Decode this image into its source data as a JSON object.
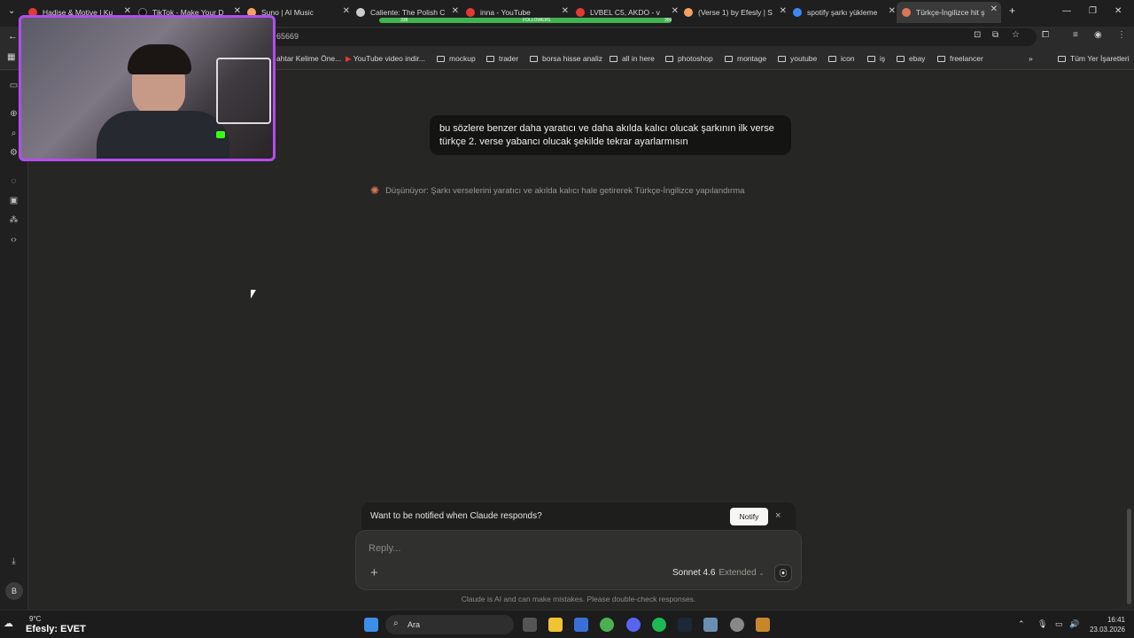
{
  "browser": {
    "tabs": [
      {
        "label": "Hadise & Motive | Ku",
        "color": "#e53935"
      },
      {
        "label": "TikTok - Make Your D",
        "color": "#111111"
      },
      {
        "label": "Suno | AI Music",
        "color": "#f4a261"
      },
      {
        "label": "Caliente: The Polish C",
        "color": "#cccccc"
      },
      {
        "label": "inna - YouTube",
        "color": "#e53935"
      },
      {
        "label": "LVBEL C5, AKDO - v",
        "color": "#e53935"
      },
      {
        "label": "(Verse 1) by Efesly | S",
        "color": "#f4a261"
      },
      {
        "label": "spotify şarkı yükleme",
        "color": "#4285f4"
      },
      {
        "label": "Türkçe-İngilizce hit ş",
        "color": "#d97757"
      }
    ],
    "follow_label": "FOLLOWERS",
    "follow_left": "338",
    "follow_right": "300",
    "url": "65669",
    "bookmarks": [
      "ahtar Kelime Öne...",
      "YouTube video indir...",
      "mockup",
      "trader",
      "borsa hisse analiz",
      "all in here",
      "photoshop",
      "montage",
      "youtube",
      "icon",
      "iş",
      "ebay",
      "freelancer"
    ],
    "all_bookmarks": "Tüm Yer İşaretleri"
  },
  "chat": {
    "user_message": "bu sözlere benzer daha yaratıcı ve daha akılda kalıcı olucak şarkının ilk verse türkçe 2. verse yabancı olucak şekilde tekrar ayarlarmısın",
    "thinking": "Düşünüyor: Şarkı verselerini yaratıcı ve akılda kalıcı hale getirerek Türkçe-İngilizce yapılandırma",
    "notify_prompt": "Want to be notified when Claude responds?",
    "notify_button": "Notify",
    "reply_placeholder": "Reply...",
    "model_name": "Sonnet 4.6",
    "model_mode": "Extended",
    "disclaimer": "Claude is AI and can make mistakes. Please double-check responses.",
    "avatar_initial": "B"
  },
  "taskbar": {
    "weather": "9°C",
    "streamer_text": "Efesly: EVET",
    "search_placeholder": "Ara",
    "time": "16:41",
    "date": "23.03.2026"
  }
}
